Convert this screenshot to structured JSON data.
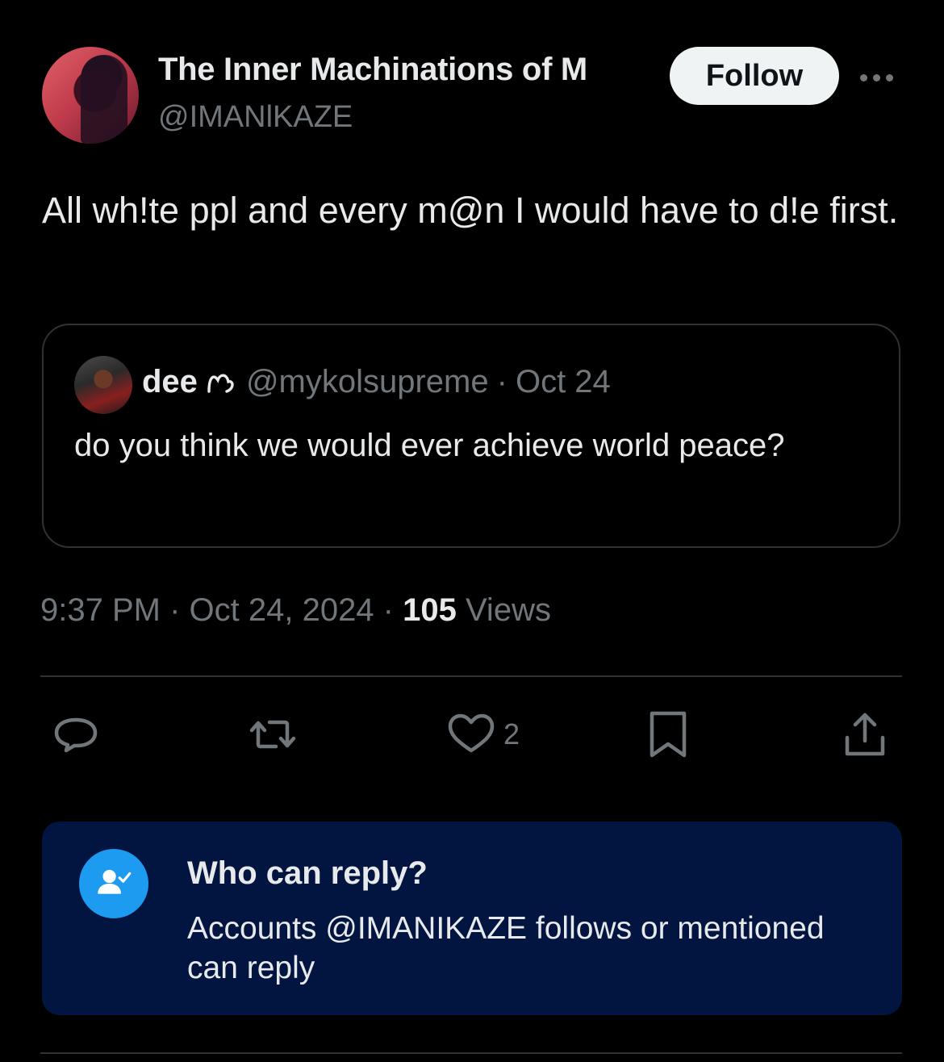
{
  "author": {
    "display_name": "The Inner Machinations of M",
    "handle": "@IMANlKAZE"
  },
  "follow_label": "Follow",
  "tweet": {
    "text": "All wh!te ppl and every m@n I would have to d!e first."
  },
  "quoted": {
    "name": "dee",
    "handle": "@mykolsupreme",
    "separator": "·",
    "date": "Oct 24",
    "text": "do you think we would ever achieve world peace?"
  },
  "meta": {
    "timestamp": "9:37 PM · Oct 24, 2024 · ",
    "views_count": "105",
    "views_label": " Views"
  },
  "actions": {
    "like_count": "2"
  },
  "reply_settings": {
    "title": "Who can reply?",
    "description": "Accounts @IMANIKAZE follows or mentioned can reply"
  },
  "colors": {
    "background": "#000000",
    "text": "#e7e9ea",
    "muted": "#71767b",
    "accent": "#1d9bf0",
    "reply_box": "#011540"
  }
}
